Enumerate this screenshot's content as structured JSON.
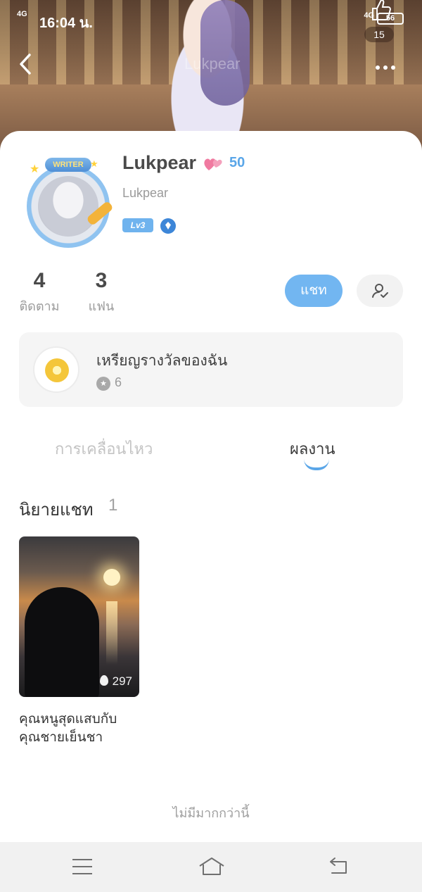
{
  "status_bar": {
    "signal": "4G",
    "time": "16:04 น.",
    "network": "4G",
    "battery": "56"
  },
  "header": {
    "like_count": "15",
    "watermark": "Lukpear"
  },
  "profile": {
    "avatar_badge": "WRITER",
    "name": "Lukpear",
    "heart_count": "50",
    "handle": "Lukpear",
    "level": "Lv3"
  },
  "stats": [
    {
      "value": "4",
      "label": "ติดตาม"
    },
    {
      "value": "3",
      "label": "แฟน"
    }
  ],
  "actions": {
    "chat_label": "แชท"
  },
  "medals": {
    "title": "เหรียญรางวัลของฉัน",
    "count": "6"
  },
  "tabs": [
    {
      "label": "การเคลื่อนไหว",
      "active": false
    },
    {
      "label": "ผลงาน",
      "active": true
    }
  ],
  "section": {
    "title": "นิยายแชท",
    "count": "1"
  },
  "stories": [
    {
      "title": "คุณหนูสุดแสบกับคุณชายเย็นชา",
      "views": "297"
    }
  ],
  "footer_text": "ไม่มีมากกว่านี้",
  "colors": {
    "accent": "#72b6f1",
    "heart_count": "#5aa6e8",
    "medal_card_bg": "#f5f5f5",
    "nav_bar_bg": "#f1f1f1"
  }
}
